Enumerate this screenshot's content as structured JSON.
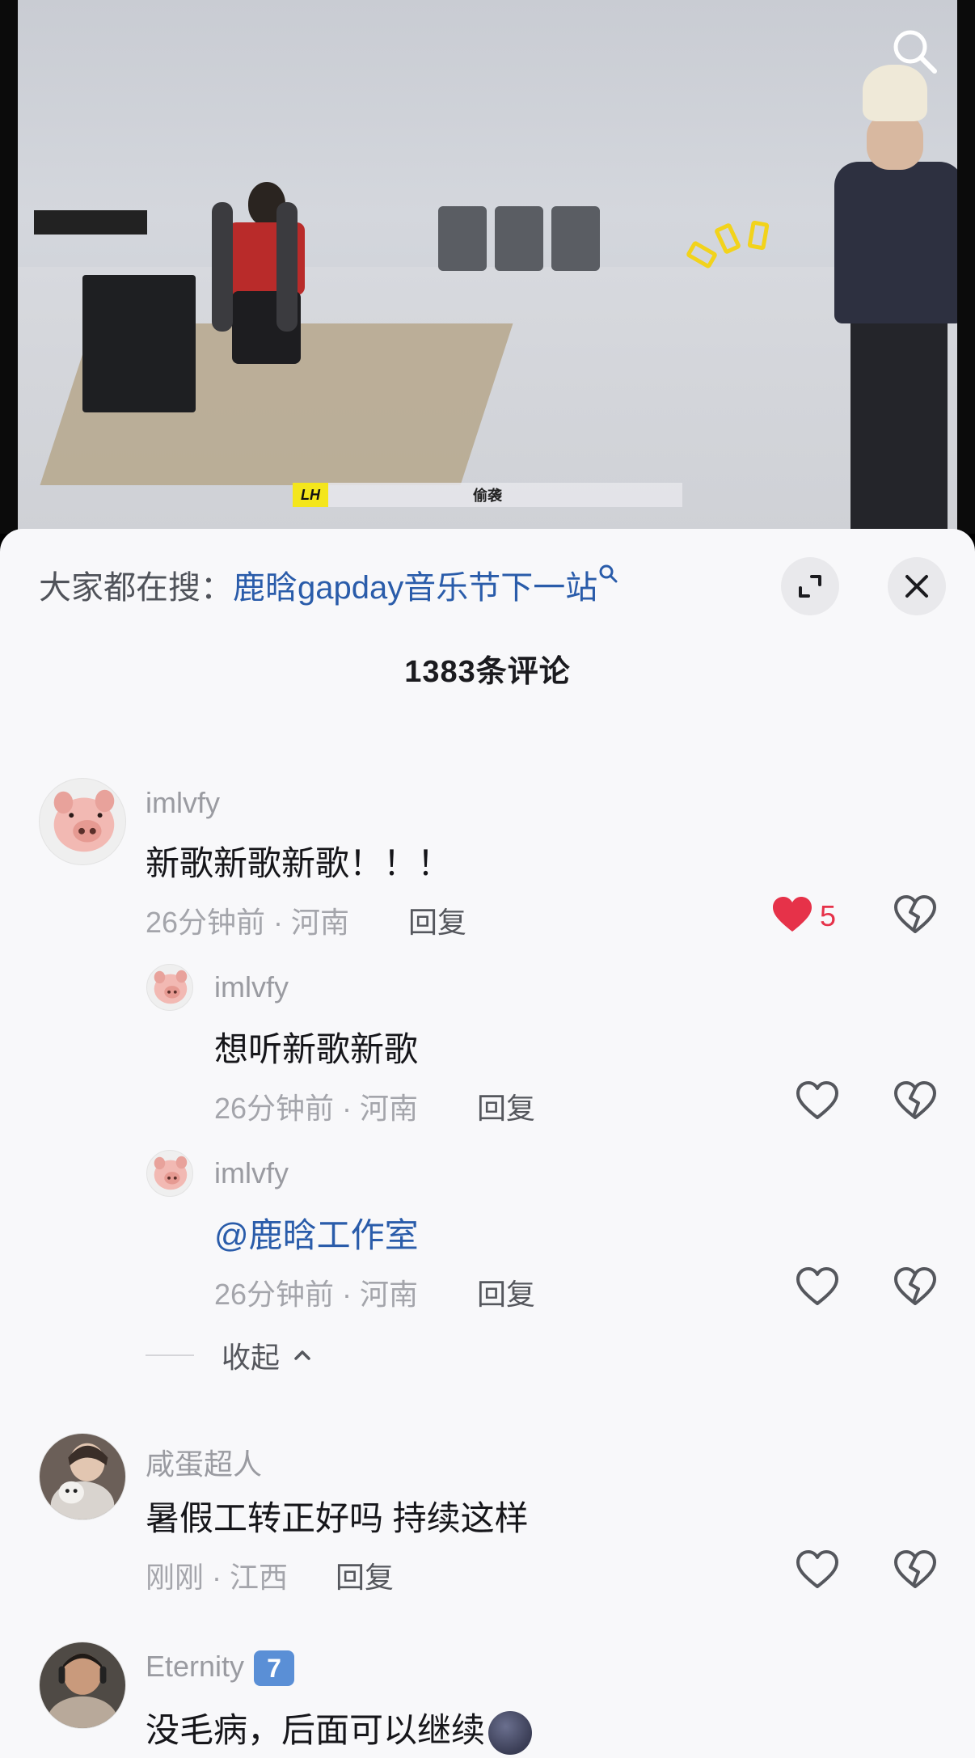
{
  "video": {
    "subtitle_logo": "LH",
    "subtitle_text": "偷袭"
  },
  "sheet": {
    "trending_prefix": "大家都在搜：",
    "trending_term": "鹿晗gapday音乐节下一站",
    "comment_count_label": "1383条评论"
  },
  "comments": [
    {
      "username": "imlvfy",
      "text": "新歌新歌新歌！！！",
      "time": "26分钟前",
      "location": "河南",
      "reply_label": "回复",
      "likes": "5",
      "liked": true,
      "replies": [
        {
          "username": "imlvfy",
          "text": "想听新歌新歌",
          "time": "26分钟前",
          "location": "河南",
          "reply_label": "回复"
        },
        {
          "username": "imlvfy",
          "text": "@鹿晗工作室",
          "time": "26分钟前",
          "location": "河南",
          "reply_label": "回复"
        }
      ],
      "collapse_label": "收起"
    },
    {
      "username": "咸蛋超人",
      "text": "暑假工转正好吗 持续这样",
      "time": "刚刚",
      "location": "江西",
      "reply_label": "回复"
    },
    {
      "username": "Eternity",
      "badge": "7",
      "text": "没毛病，后面可以继续",
      "emoji": "dark-moon-face-emoji"
    }
  ],
  "colors": {
    "like_red": "#e63249",
    "link_blue": "#2a5caa",
    "sheet_bg": "#f8f8fa"
  },
  "icons": [
    "search-icon",
    "expand-icon",
    "close-icon",
    "heart-icon",
    "broken-heart-icon",
    "chevron-up-icon"
  ]
}
